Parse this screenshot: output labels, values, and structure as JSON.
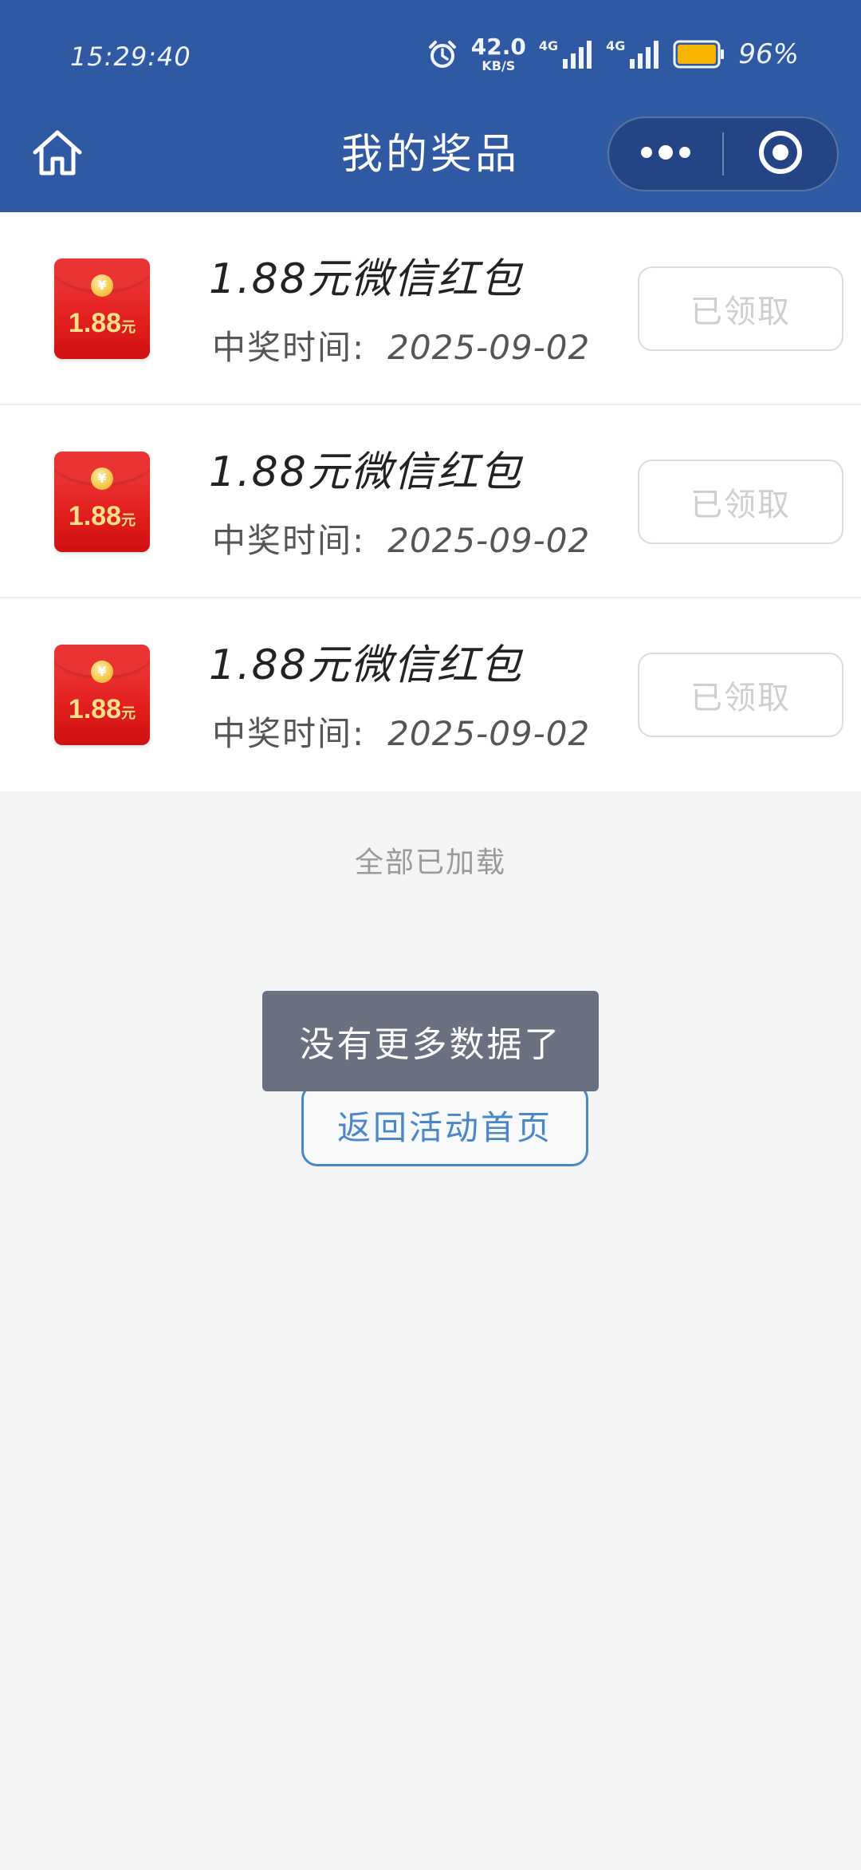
{
  "status_bar": {
    "time": "15:29:40",
    "net_speed_value": "42.0",
    "net_speed_unit": "KB/S",
    "signal_1_label": "4G",
    "signal_2_label": "4G",
    "battery_percent": "96%",
    "icons": [
      "alarm-icon",
      "signal-icon",
      "battery-icon"
    ]
  },
  "header": {
    "title": "我的奖品",
    "home_icon": "home-icon",
    "more_icon": "more-dots-icon",
    "close_icon": "target-circle-icon",
    "bg_color": "#2f5aa3"
  },
  "prizes": [
    {
      "name": "1.88元微信红包",
      "time_label": "中奖时间:",
      "date": "2025-09-02",
      "button_label": "已领取",
      "packet_amount": "1.88",
      "packet_unit": "元",
      "packet_coin": "¥"
    },
    {
      "name": "1.88元微信红包",
      "time_label": "中奖时间:",
      "date": "2025-09-02",
      "button_label": "已领取",
      "packet_amount": "1.88",
      "packet_unit": "元",
      "packet_coin": "¥"
    },
    {
      "name": "1.88元微信红包",
      "time_label": "中奖时间:",
      "date": "2025-09-02",
      "button_label": "已领取",
      "packet_amount": "1.88",
      "packet_unit": "元",
      "packet_coin": "¥"
    }
  ],
  "footer": {
    "all_loaded": "全部已加载",
    "toast": "没有更多数据了",
    "back_button": "返回活动首页"
  }
}
